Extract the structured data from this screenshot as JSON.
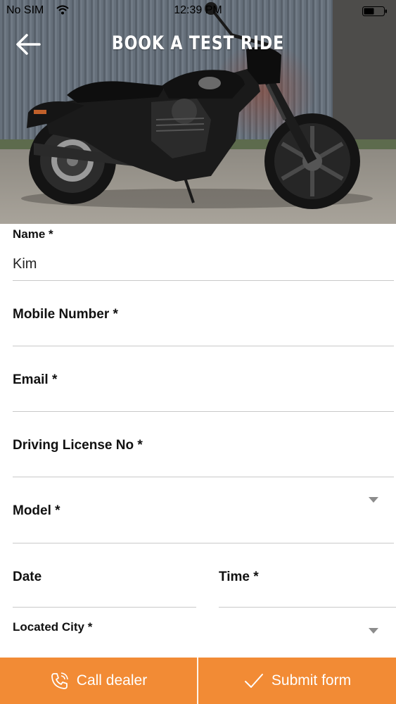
{
  "status_bar": {
    "carrier": "No SIM",
    "time": "12:39 PM"
  },
  "header": {
    "title": "BOOK A TEST RIDE"
  },
  "form": {
    "name": {
      "label": "Name *",
      "value": "Kim"
    },
    "mobile": {
      "label": "Mobile Number *",
      "value": ""
    },
    "email": {
      "label": "Email *",
      "value": ""
    },
    "license": {
      "label": "Driving License No *",
      "value": ""
    },
    "model": {
      "label": "Model *",
      "value": ""
    },
    "date": {
      "label": "Date",
      "value": ""
    },
    "time": {
      "label": "Time *",
      "value": ""
    },
    "city": {
      "label": "Located City *",
      "value": ""
    }
  },
  "actions": {
    "call_label": "Call dealer",
    "submit_label": "Submit form"
  },
  "icons": {
    "back": "arrow-left-icon",
    "call": "phone-call-icon",
    "submit": "checkmark-icon",
    "dropdown": "triangle-down-icon",
    "wifi": "wifi-icon",
    "battery": "battery-icon"
  },
  "colors": {
    "accent": "#f28b35",
    "divider": "#c9c9c9",
    "dropdown": "#8c8c8c"
  }
}
